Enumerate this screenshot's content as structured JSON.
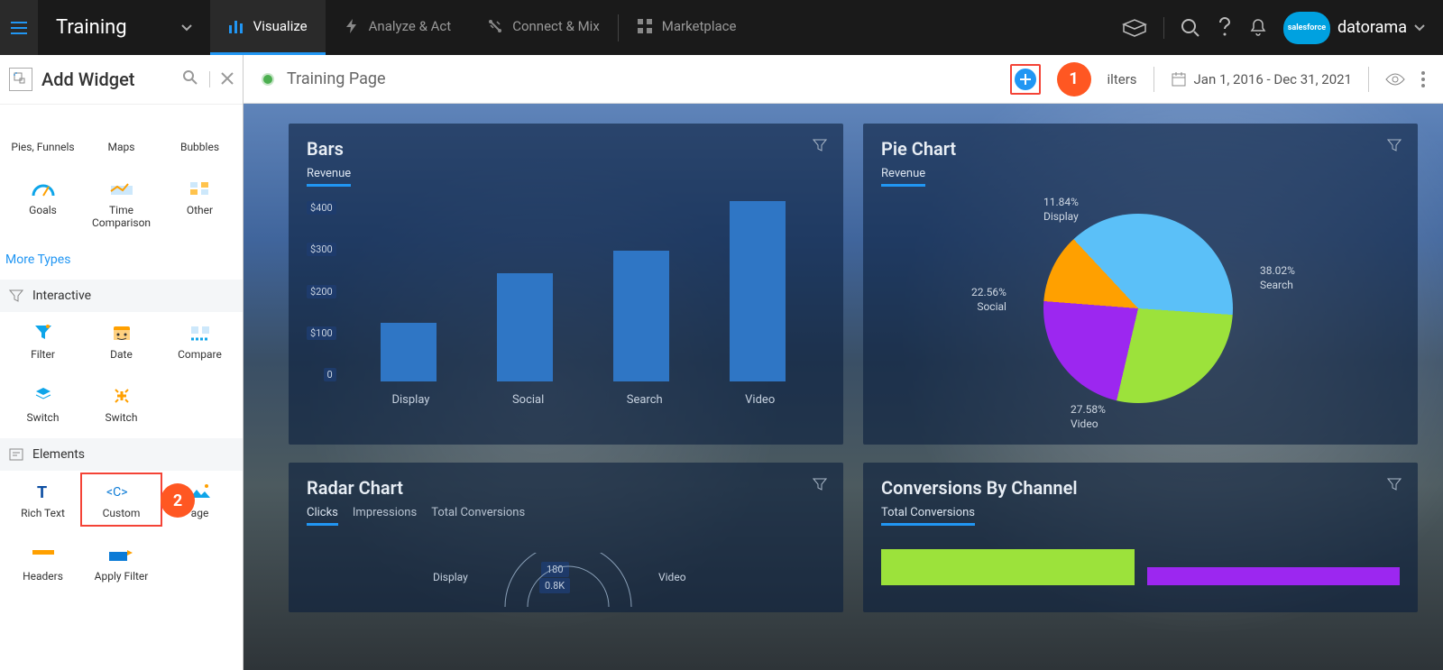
{
  "workspace": {
    "name": "Training"
  },
  "nav": {
    "tabs": [
      {
        "label": "Visualize",
        "active": true
      },
      {
        "label": "Analyze & Act",
        "active": false
      },
      {
        "label": "Connect & Mix",
        "active": false
      },
      {
        "label": "Marketplace",
        "active": false
      }
    ]
  },
  "brand": {
    "cloud": "salesforce",
    "name": "datorama"
  },
  "page": {
    "title": "Training Page",
    "filters_label": "ilters",
    "date_range": "Jan 1, 2016 - Dec 31, 2021"
  },
  "callouts": {
    "one": "1",
    "two": "2"
  },
  "sidebar": {
    "title": "Add Widget",
    "row1": [
      {
        "label": "Pies, Funnels"
      },
      {
        "label": "Maps"
      },
      {
        "label": "Bubbles"
      }
    ],
    "row2": [
      {
        "label": "Goals"
      },
      {
        "label": "Time Comparison"
      },
      {
        "label": "Other"
      }
    ],
    "more_types": "More Types",
    "section_interactive": "Interactive",
    "interactive": [
      {
        "label": "Filter"
      },
      {
        "label": "Date"
      },
      {
        "label": "Compare"
      },
      {
        "label": "Switch"
      },
      {
        "label": "Switch"
      }
    ],
    "section_elements": "Elements",
    "elements": [
      {
        "label": "Rich Text"
      },
      {
        "label": "Custom"
      },
      {
        "label": "age"
      },
      {
        "label": "Headers"
      },
      {
        "label": "Apply Filter"
      }
    ]
  },
  "widgets": {
    "bars": {
      "title": "Bars",
      "metric": "Revenue"
    },
    "pie": {
      "title": "Pie Chart",
      "metric": "Revenue"
    },
    "radar": {
      "title": "Radar Chart",
      "metrics": [
        "Clicks",
        "Impressions",
        "Total Conversions"
      ],
      "axis_labels": [
        "Display",
        "Video"
      ],
      "tick_labels": [
        "180",
        "0.8K"
      ]
    },
    "conv": {
      "title": "Conversions By Channel",
      "metric": "Total Conversions"
    }
  },
  "chart_data": [
    {
      "id": "bars",
      "type": "bar",
      "title": "Bars – Revenue",
      "categories": [
        "Display",
        "Social",
        "Search",
        "Video"
      ],
      "values": [
        130,
        240,
        290,
        400
      ],
      "ylabel": "Revenue ($)",
      "ylim": [
        0,
        400
      ],
      "yticks": [
        "$400",
        "$300",
        "$200",
        "$100",
        "0"
      ]
    },
    {
      "id": "pie",
      "type": "pie",
      "title": "Pie Chart – Revenue",
      "series": [
        {
          "name": "Search",
          "value": 38.02,
          "color": "#5bc0f8"
        },
        {
          "name": "Video",
          "value": 27.58,
          "color": "#9ce23b"
        },
        {
          "name": "Social",
          "value": 22.56,
          "color": "#9c27f0"
        },
        {
          "name": "Display",
          "value": 11.84,
          "color": "#ffa000"
        }
      ]
    }
  ]
}
